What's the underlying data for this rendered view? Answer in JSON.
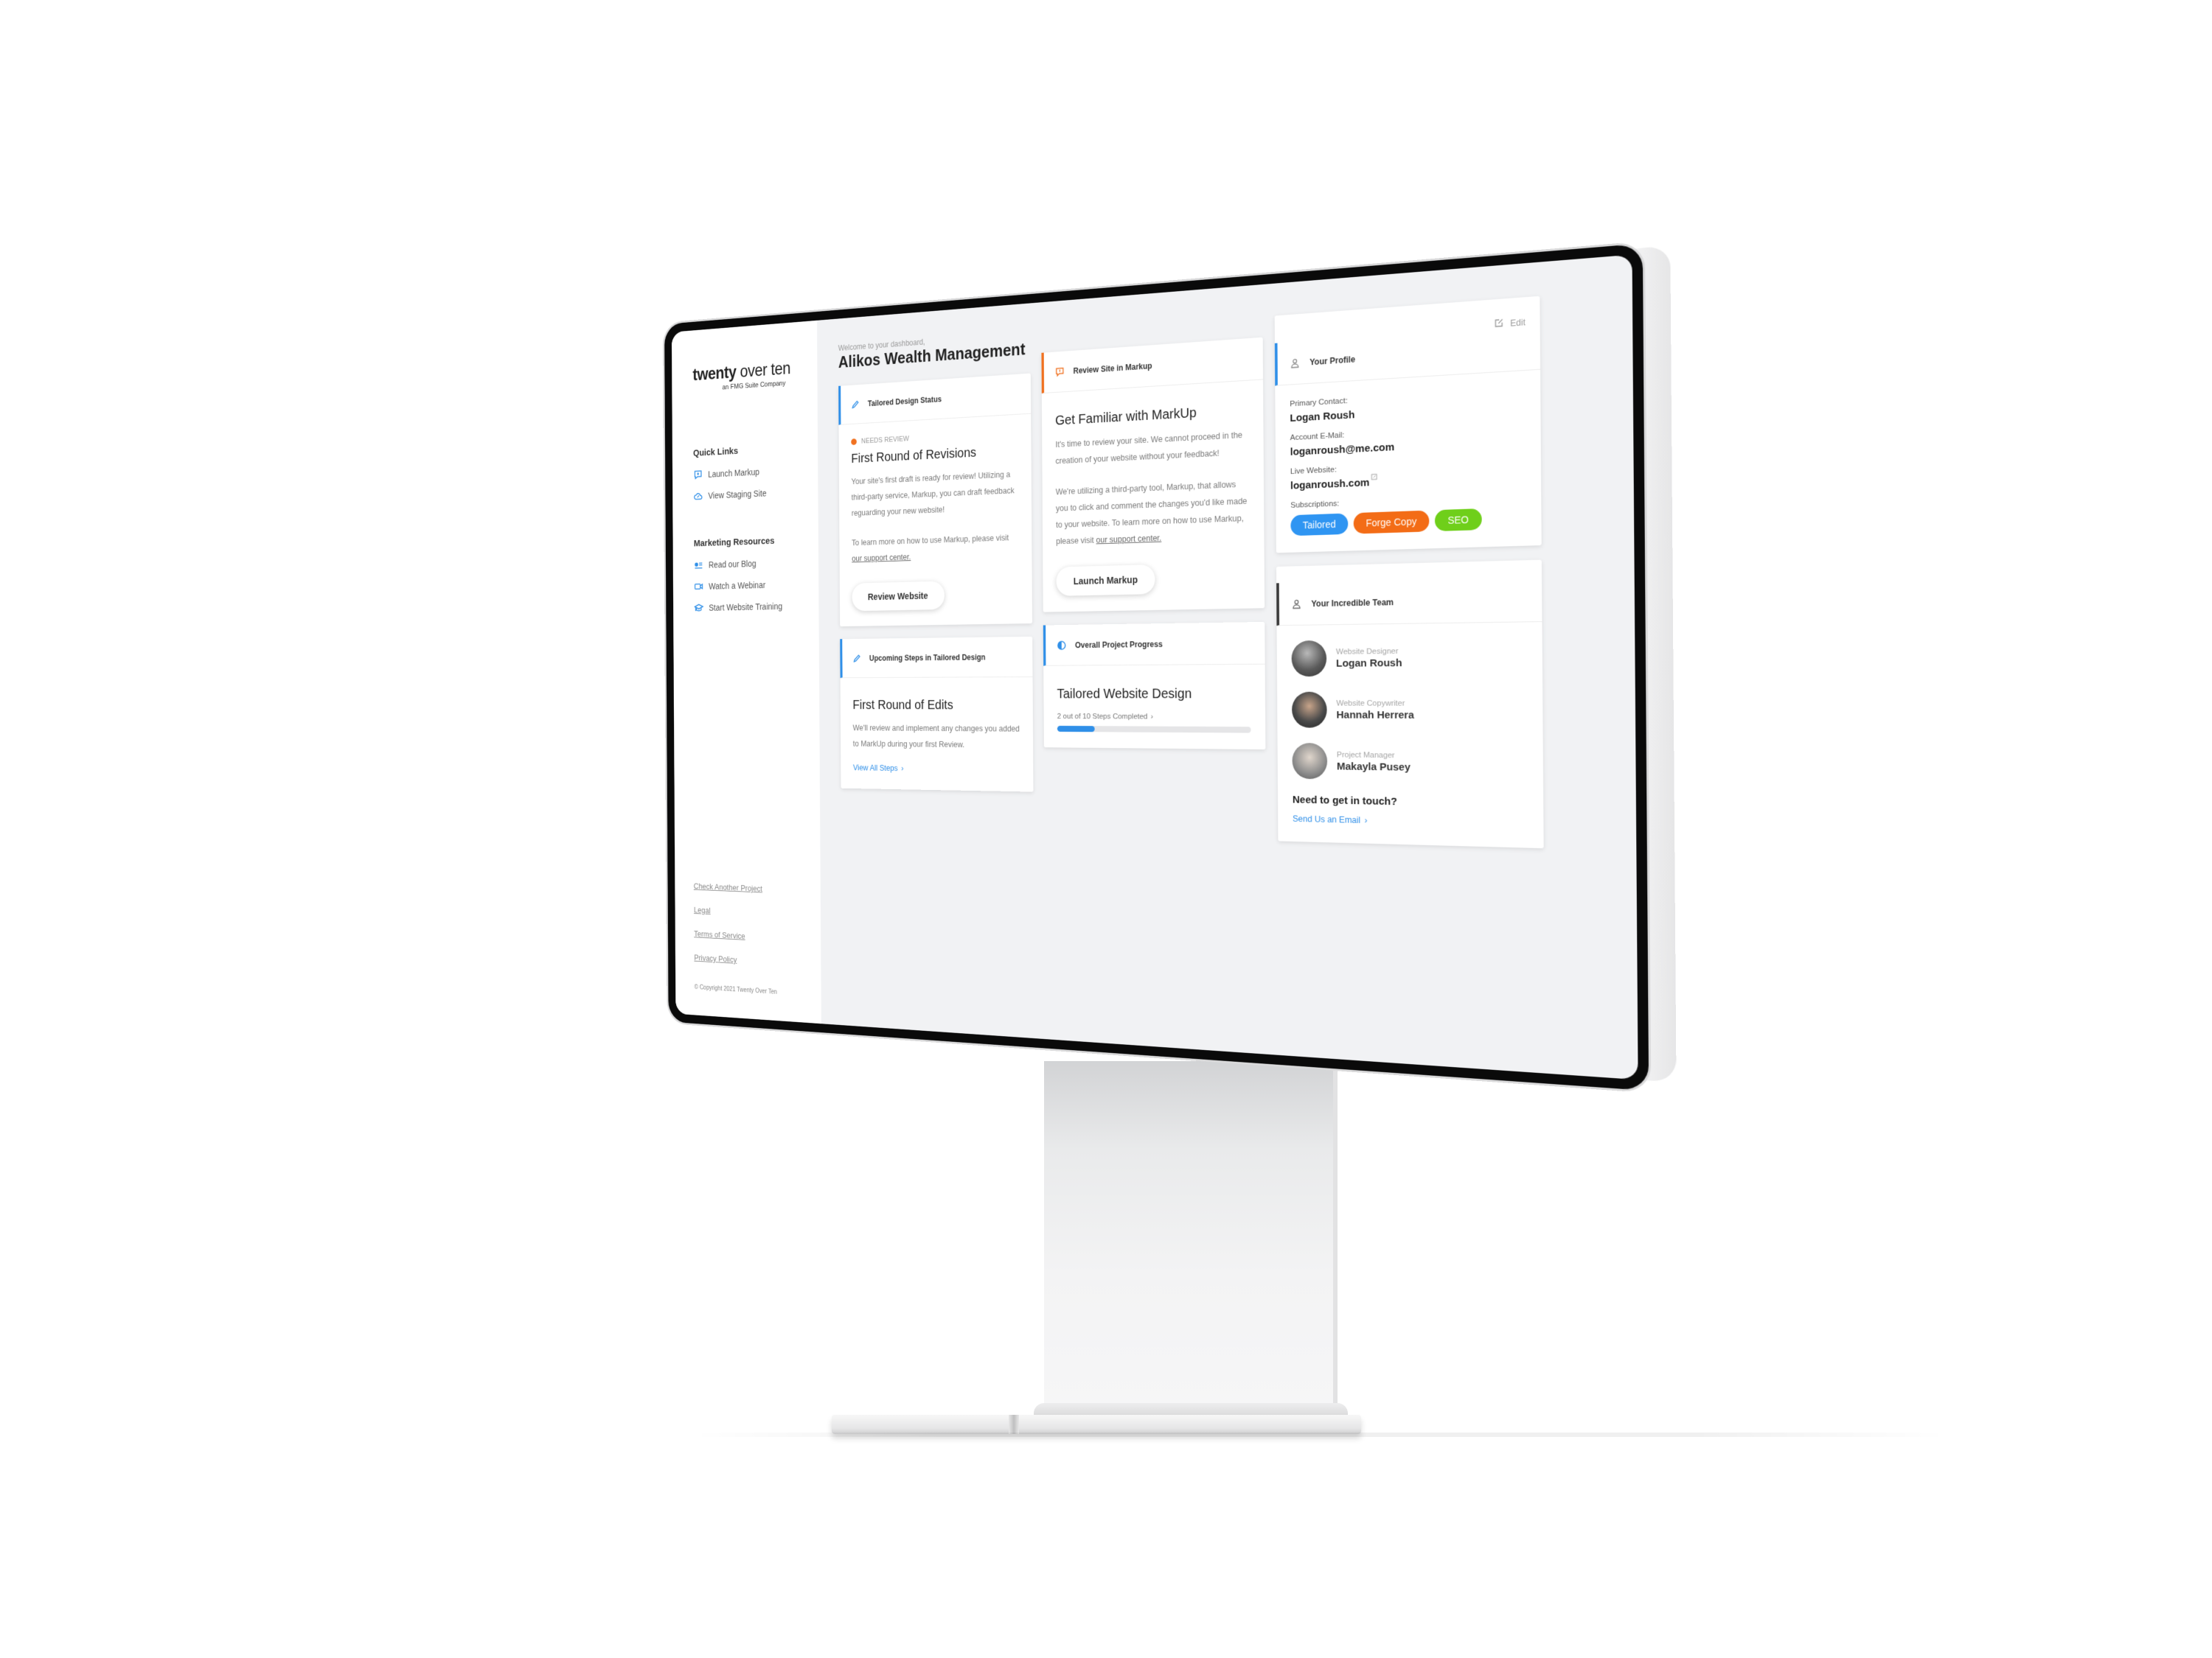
{
  "sidebar": {
    "logo_bold": "twenty",
    "logo_rest": " over ten",
    "logo_sub": "an FMG Suite Company",
    "quick_links": {
      "heading": "Quick Links",
      "items": [
        {
          "label": "Launch Markup",
          "icon": "chat-plus-icon"
        },
        {
          "label": "View Staging Site",
          "icon": "cloud-link-icon"
        }
      ]
    },
    "marketing": {
      "heading": "Marketing Resources",
      "items": [
        {
          "label": "Read our Blog",
          "icon": "blog-icon"
        },
        {
          "label": "Watch a Webinar",
          "icon": "video-camera-icon"
        },
        {
          "label": "Start Website Training",
          "icon": "graduation-cap-icon"
        }
      ]
    },
    "footer_links": [
      "Check Another Project",
      "Legal",
      "Terms of Service",
      "Privacy Policy"
    ],
    "copyright": "© Copyright 2021 Twenty Over Ten"
  },
  "header": {
    "welcome": "Welcome to your dashboard,",
    "title": "Alikos Wealth Management"
  },
  "cards": {
    "design_status": {
      "header": "Tailored Design Status",
      "status": "NEEDS REVIEW",
      "title": "First Round of Revisions",
      "text1": "Your site's first draft is ready for review! Utilizing a third-party service, Markup, you can draft feedback reguarding your new website!",
      "text2": "To learn more on how to use Markup, please visit ",
      "link": "our support center.",
      "button": "Review Website"
    },
    "upcoming": {
      "header": "Upcoming Steps in Tailored Design",
      "title": "First Round of Edits",
      "text": "We'll review and implement any changes you added to MarkUp during your first Review.",
      "link": "View All Steps"
    },
    "markup": {
      "header": "Review Site in Markup",
      "title": "Get Familiar with MarkUp",
      "text1": "It's time to review your site. We cannot proceed in the creation of your website without your feedback!",
      "text2": "We're utilizing a third-party tool, Markup, that allows you to click and comment the changes you'd like made to your website. To learn more on how to use Markup, please visit ",
      "link": "our support center.",
      "button": "Launch Markup"
    },
    "progress": {
      "header": "Overall Project Progress",
      "title": "Tailored Website Design",
      "label": "2 out of 10 Steps Completed",
      "completed": 2,
      "total": 10,
      "fraction": 0.2
    },
    "profile": {
      "header": "Your Profile",
      "edit": "Edit",
      "primary_contact_label": "Primary Contact:",
      "primary_contact": "Logan Roush",
      "email_label": "Account E-Mail:",
      "email": "loganroush@me.com",
      "website_label": "Live Website:",
      "website": "loganroush.com",
      "subscriptions_label": "Subscriptions:",
      "subscriptions": [
        {
          "label": "Tailored",
          "color": "#2f95f2"
        },
        {
          "label": "Forge Copy",
          "color": "#f36c16"
        },
        {
          "label": "SEO",
          "color": "#6fcf1a"
        }
      ]
    },
    "team": {
      "header": "Your Incredible Team",
      "members": [
        {
          "role": "Website Designer",
          "name": "Logan Roush"
        },
        {
          "role": "Website Copywriter",
          "name": "Hannah Herrera"
        },
        {
          "role": "Project Manager",
          "name": "Makayla Pusey"
        }
      ],
      "touch_title": "Need to get in touch?",
      "email_link": "Send Us an Email"
    }
  },
  "colors": {
    "accent_blue": "#2f8fe8",
    "accent_orange": "#f07120",
    "screen_bg": "#f1f2f4"
  }
}
